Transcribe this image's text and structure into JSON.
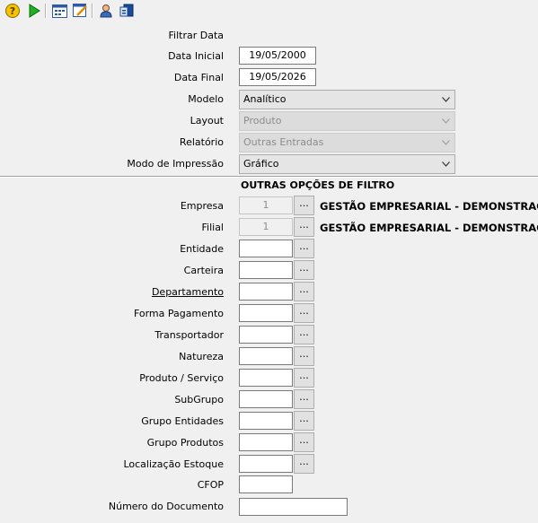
{
  "toolbar": {
    "icons": [
      "help-icon",
      "run-icon",
      "calendar-icon",
      "edit-report-icon",
      "user-icon",
      "export-icon"
    ]
  },
  "form": {
    "filtrar_data": "Filtrar Data",
    "data_inicial_label": "Data Inicial",
    "data_inicial": "19/05/2000",
    "data_final_label": "Data Final",
    "data_final": "19/05/2026",
    "modelo_label": "Modelo",
    "modelo": "Analítico",
    "layout_label": "Layout",
    "layout": "Produto",
    "relatorio_label": "Relatório",
    "relatorio": "Outras Entradas",
    "modo_label": "Modo de Impressão",
    "modo": "Gráfico"
  },
  "filters": {
    "title": "OUTRAS OPÇÕES DE FILTRO",
    "empresa_label": "Empresa",
    "empresa_code": "1",
    "empresa_name": "GESTÃO EMPRESARIAL - DEMONSTRAÇÃO",
    "filial_label": "Filial",
    "filial_code": "1",
    "filial_name": "GESTÃO EMPRESARIAL - DEMONSTRAÇÃO",
    "entidade": "Entidade",
    "carteira": "Carteira",
    "departamento": "Departamento",
    "forma_pagamento": "Forma Pagamento",
    "transportador": "Transportador",
    "natureza": "Natureza",
    "produto_servico": "Produto / Serviço",
    "subgrupo": "SubGrupo",
    "grupo_entidades": "Grupo Entidades",
    "grupo_produtos": "Grupo Produtos",
    "localizacao_estoque": "Localização Estoque",
    "cfop": "CFOP",
    "numero_documento": "Número do Documento",
    "lookup_button": "..."
  }
}
